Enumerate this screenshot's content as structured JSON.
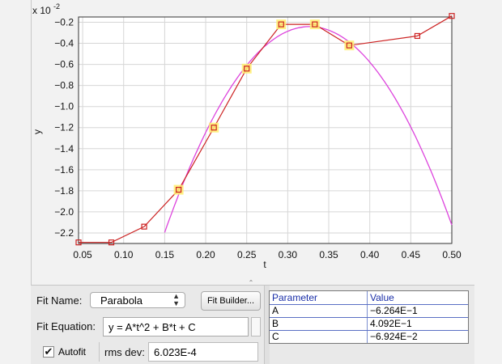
{
  "chart_data": {
    "type": "scatter",
    "title": "",
    "xlabel": "t",
    "ylabel": "y",
    "y_scale_label": "x 10",
    "y_scale_exponent": "-2",
    "xlim": [
      0.045,
      0.5
    ],
    "ylim": [
      -2.3,
      -0.15
    ],
    "xticks": [
      "0.05",
      "0.10",
      "0.15",
      "0.20",
      "0.25",
      "0.30",
      "0.35",
      "0.40",
      "0.45",
      "0.50"
    ],
    "yticks": [
      "-0.2",
      "-0.4",
      "-0.6",
      "-0.8",
      "-1.0",
      "-1.2",
      "-1.4",
      "-1.6",
      "-1.8",
      "-2.0",
      "-2.2"
    ],
    "grid": true,
    "series": [
      {
        "color": "#cc2222",
        "x": [
          0.045,
          0.085,
          0.125,
          0.167,
          0.21,
          0.25,
          0.292,
          0.333,
          0.375,
          0.458,
          0.5
        ],
        "y": [
          -2.29,
          -2.29,
          -2.14,
          -1.79,
          -1.2,
          -0.64,
          -0.22,
          -0.22,
          -0.42,
          -0.33,
          -0.14
        ],
        "highlighted": [
          false,
          false,
          false,
          true,
          true,
          true,
          true,
          true,
          true,
          false,
          false
        ]
      },
      {
        "color": "#dd44dd",
        "fit": {
          "A": -0.6264,
          "B": 0.4092,
          "C": -0.06924
        },
        "x_range": [
          0.15,
          0.5
        ]
      }
    ]
  },
  "fit_panel": {
    "fit_name_label": "Fit Name:",
    "fit_name_value": "Parabola",
    "fit_builder_label": "Fit Builder...",
    "fit_equation_label": "Fit Equation:",
    "fit_equation_value": "y = A*t^2 + B*t + C",
    "autofit_label": "Autofit",
    "autofit_checked": true,
    "rms_label": "rms dev:",
    "rms_value": "6.023E-4"
  },
  "param_table": {
    "headers": [
      "Parameter",
      "Value"
    ],
    "rows": [
      {
        "name": "A",
        "value": "−6.264E−1"
      },
      {
        "name": "B",
        "value": "4.092E−1"
      },
      {
        "name": "C",
        "value": "−6.924E−2"
      }
    ]
  },
  "colors": {
    "data_line": "#cc2222",
    "fit_curve": "#dd44dd",
    "highlight": "#ffef70",
    "table_header_text": "#1a2fa8"
  }
}
